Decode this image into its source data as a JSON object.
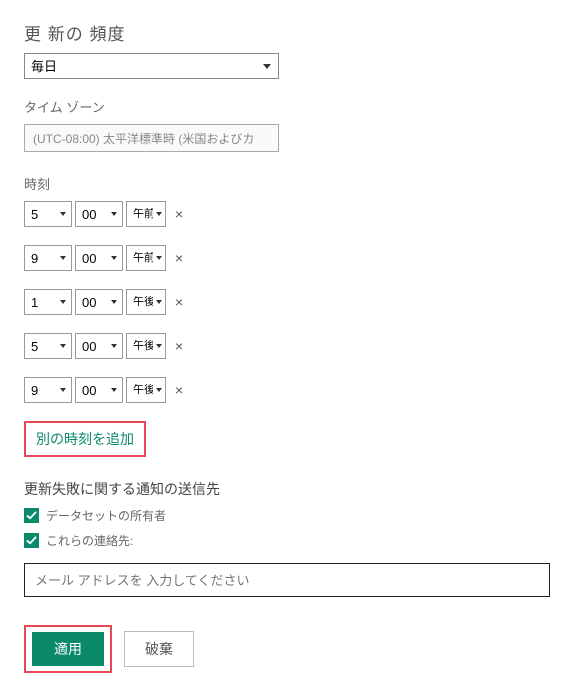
{
  "frequency": {
    "title": "更 新の 頻度",
    "value": "毎日"
  },
  "timezone": {
    "label": "タイム ゾーン",
    "value": "(UTC-08:00) 太平洋標準時 (米国およびカ"
  },
  "time": {
    "label": "時刻",
    "rows": [
      {
        "hour": "5",
        "minute": "00",
        "ampm": "午前"
      },
      {
        "hour": "9",
        "minute": "00",
        "ampm": "午前"
      },
      {
        "hour": "1",
        "minute": "00",
        "ampm": "午後"
      },
      {
        "hour": "5",
        "minute": "00",
        "ampm": "午後"
      },
      {
        "hour": "9",
        "minute": "00",
        "ampm": "午後"
      }
    ],
    "add_label": "別の時刻を追加",
    "remove_symbol": "×"
  },
  "notify": {
    "title": "更新失敗に関する通知の送信先",
    "owner_label": "データセットの所有者",
    "contacts_label": "これらの連絡先:",
    "email_placeholder": "メール アドレスを 入力してください"
  },
  "buttons": {
    "apply": "適用",
    "discard": "破棄"
  }
}
